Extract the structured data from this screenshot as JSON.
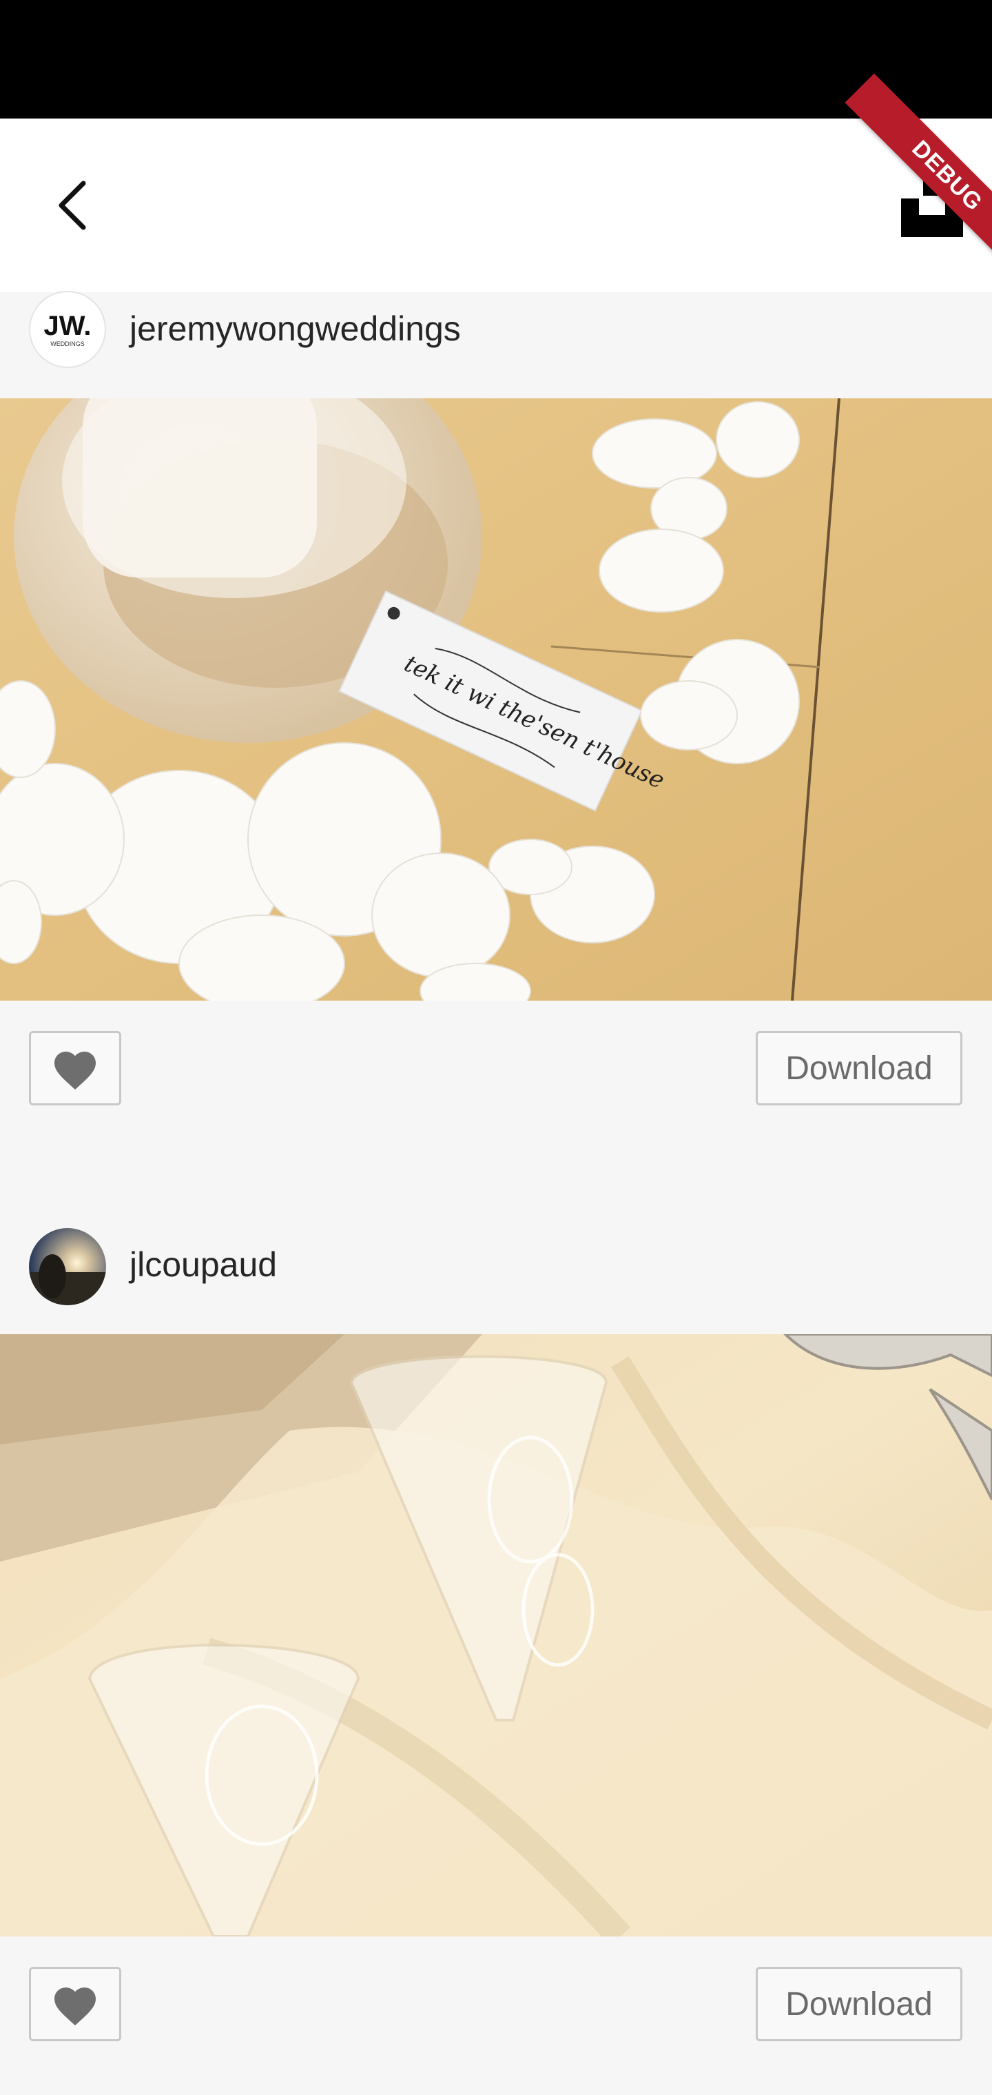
{
  "debug_banner": "DEBUG",
  "icons": {
    "back": "back-arrow-icon",
    "share": "share-icon",
    "like": "heart-icon"
  },
  "colors": {
    "status_bar": "#000000",
    "debug": "#b71c2b",
    "button_border": "#c8c8c8"
  },
  "posts": [
    {
      "username": "jeremywongweddings",
      "avatar_text": "JW.",
      "avatar_subtext": "WEDDINGS",
      "photo_caption_text": "tek it wi the'sen t'house",
      "download_label": "Download"
    },
    {
      "username": "jlcoupaud",
      "download_label": "Download"
    }
  ]
}
